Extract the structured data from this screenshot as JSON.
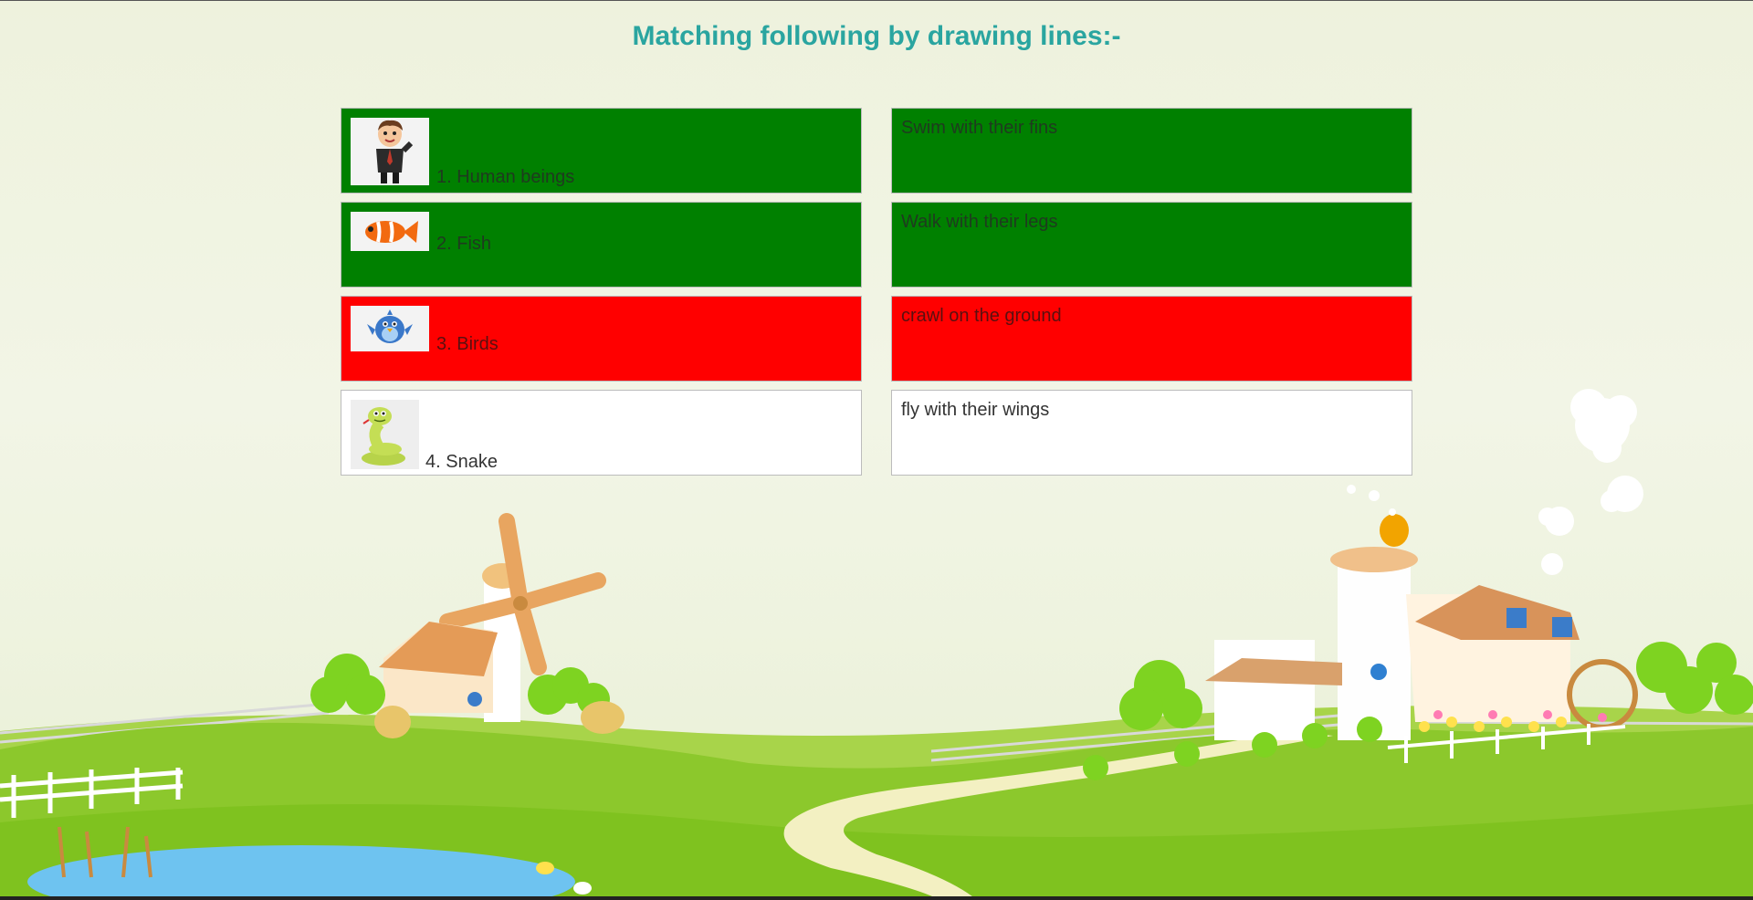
{
  "header": {
    "title": "Matching following by drawing lines:-"
  },
  "left_items": [
    {
      "label": "1. Human beings",
      "icon": "human-icon",
      "state": "green"
    },
    {
      "label": "2. Fish",
      "icon": "fish-icon",
      "state": "green"
    },
    {
      "label": "3. Birds",
      "icon": "bird-icon",
      "state": "red"
    },
    {
      "label": "4. Snake",
      "icon": "snake-icon",
      "state": "white"
    }
  ],
  "right_items": [
    {
      "label": "Swim with their fins",
      "state": "green"
    },
    {
      "label": "Walk with their legs",
      "state": "green"
    },
    {
      "label": "crawl on the ground",
      "state": "red"
    },
    {
      "label": "fly with their wings",
      "state": "white"
    }
  ],
  "colors": {
    "title": "#2aa5a0",
    "correct": "#008000",
    "wrong": "#ff0000",
    "unmatched": "#ffffff"
  }
}
